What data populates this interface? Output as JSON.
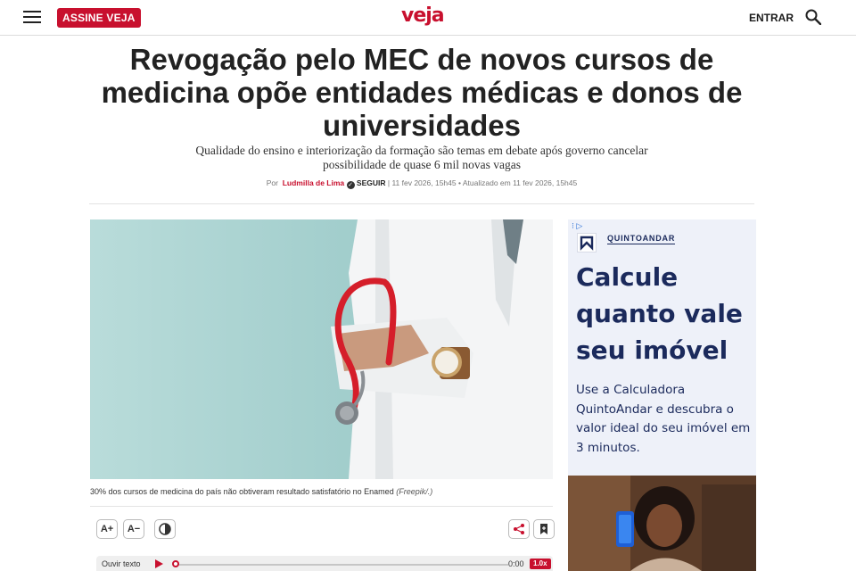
{
  "header": {
    "subscribe_label": "ASSINE VEJA",
    "logo_text": "veja",
    "login_label": "ENTRAR",
    "icons": [
      "menu-icon",
      "search-icon"
    ]
  },
  "article": {
    "headline": "Revogação pelo MEC de novos cursos de medicina opõe entidades médicas e donos de universidades",
    "subheadline": "Qualidade do ensino e interiorização da formação são temas em debate após governo cancelar possibilidade de quase 6 mil novas vagas",
    "byline": {
      "prefix": "Por",
      "author": "Ludmilla de Lima",
      "follow_label": "SEGUIR",
      "published": "| 11 fev 2026, 15h45",
      "updated": "• Atualizado em 11 fev 2026, 15h45"
    },
    "image": {
      "caption": "30% dos cursos de medicina do país não obtiveram resultado satisfatório no Enamed",
      "credit": "(Freepik/.)"
    },
    "tools": {
      "font_increase": "A+",
      "font_decrease": "A−"
    },
    "audio": {
      "label": "Ouvir texto",
      "time": "0:00",
      "speed": "1.0x",
      "progress": 0
    }
  },
  "ad": {
    "brand": "QUINTOANDAR",
    "title": "Calcule quanto vale seu imóvel",
    "body": "Use a Calculadora QuintoAndar e descubra o valor ideal do seu imóvel em 3 minutos.",
    "colors": {
      "text": "#1b2a5c",
      "background": "#eef1f9"
    }
  },
  "colors": {
    "brand_red": "#c8102e"
  }
}
